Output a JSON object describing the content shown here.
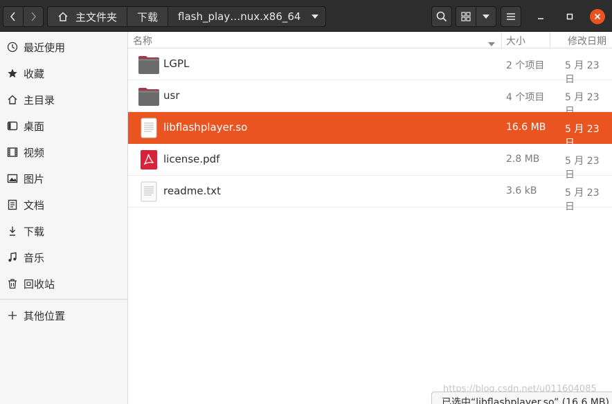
{
  "breadcrumb": {
    "home": "主文件夹",
    "downloads": "下载",
    "current": "flash_play…nux.x86_64"
  },
  "sidebar": {
    "items": [
      {
        "label": "最近使用",
        "icon": "clock-icon"
      },
      {
        "label": "收藏",
        "icon": "star-icon"
      },
      {
        "label": "主目录",
        "icon": "home-icon"
      },
      {
        "label": "桌面",
        "icon": "desktop-icon"
      },
      {
        "label": "视频",
        "icon": "video-icon"
      },
      {
        "label": "图片",
        "icon": "picture-icon"
      },
      {
        "label": "文档",
        "icon": "document-icon"
      },
      {
        "label": "下载",
        "icon": "download-icon"
      },
      {
        "label": "音乐",
        "icon": "music-icon"
      },
      {
        "label": "回收站",
        "icon": "trash-icon"
      }
    ],
    "other": {
      "label": "其他位置",
      "icon": "plus-icon"
    }
  },
  "columns": {
    "name": "名称",
    "size": "大小",
    "modified": "修改日期"
  },
  "files": [
    {
      "name": "LGPL",
      "size": "2 个项目",
      "date": "5 月 23 日",
      "type": "folder"
    },
    {
      "name": "usr",
      "size": "4 个项目",
      "date": "5 月 23 日",
      "type": "folder"
    },
    {
      "name": "libflashplayer.so",
      "size": "16.6 MB",
      "date": "5 月 23 日",
      "type": "text",
      "selected": true
    },
    {
      "name": "license.pdf",
      "size": "2.8 MB",
      "date": "5 月 23 日",
      "type": "pdf"
    },
    {
      "name": "readme.txt",
      "size": "3.6 kB",
      "date": "5 月 23 日",
      "type": "text"
    }
  ],
  "status": "已选中“libflashplayer.so” (16.6 MB)",
  "watermark": "https://blog.csdn.net/u011604085",
  "colors": {
    "accent": "#e95420",
    "headerbar": "#2d2d2d",
    "sidebar": "#f6f6f6"
  }
}
